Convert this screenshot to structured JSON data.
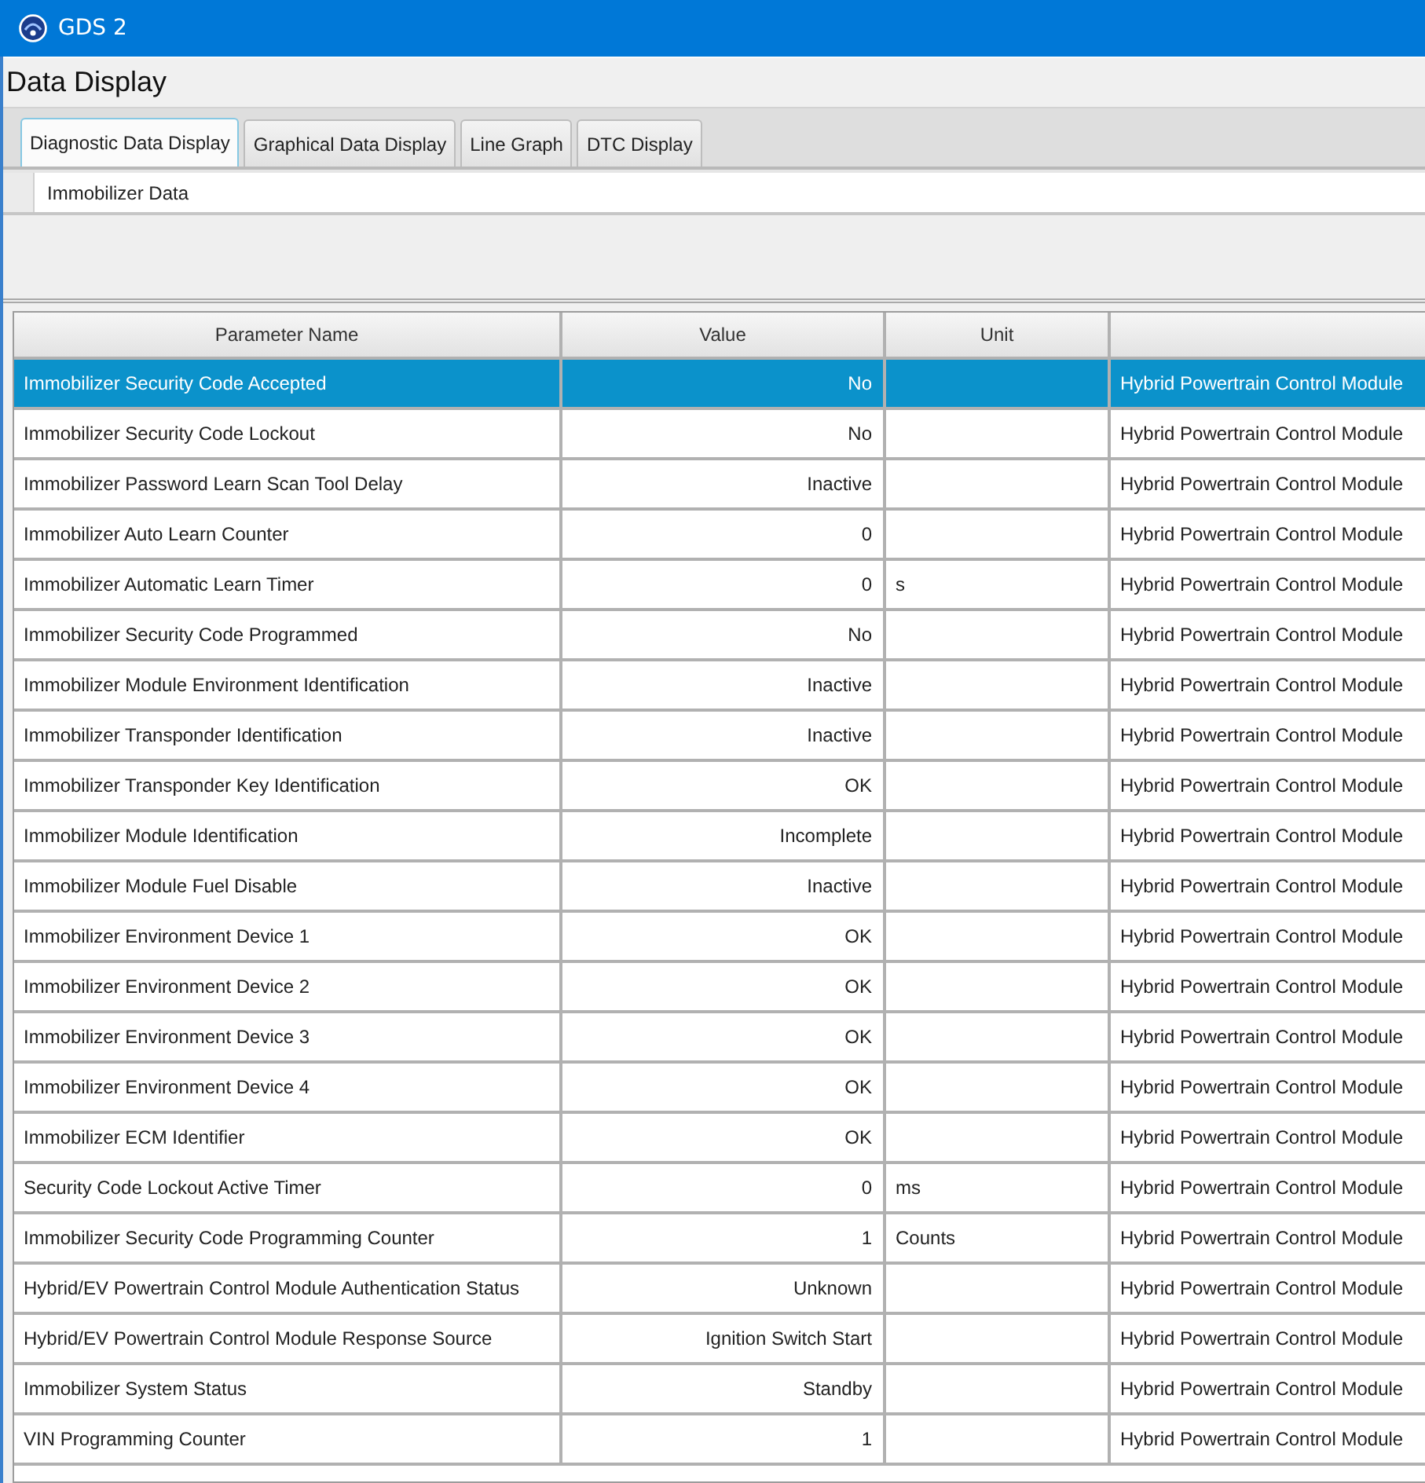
{
  "window": {
    "title": "GDS 2"
  },
  "header": {
    "title": "Data Display"
  },
  "tabs": [
    {
      "label": "Diagnostic Data Display",
      "selected": true
    },
    {
      "label": "Graphical Data Display",
      "selected": false
    },
    {
      "label": "Line Graph",
      "selected": false
    },
    {
      "label": "DTC Display",
      "selected": false
    }
  ],
  "group": {
    "label": "Immobilizer Data"
  },
  "table": {
    "columns": [
      "Parameter Name",
      "Value",
      "Unit"
    ],
    "rows": [
      {
        "parameter_name": "Immobilizer Security Code Accepted",
        "value": "No",
        "column_4": "Hybrid Powertrain Control Module",
        "selected": true
      },
      {
        "parameter_name": "Immobilizer Security Code Lockout",
        "value": "No",
        "column_4": "Hybrid Powertrain Control Module",
        "selected": false
      },
      {
        "parameter_name": "Immobilizer Password Learn Scan Tool Delay",
        "value": "Inactive",
        "column_4": "Hybrid Powertrain Control Module",
        "selected": false
      },
      {
        "parameter_name": "Immobilizer Auto Learn Counter",
        "value": "0",
        "column_4": "Hybrid Powertrain Control Module",
        "selected": false
      },
      {
        "parameter_name": "Immobilizer Automatic Learn Timer",
        "value": "0",
        "unit": "s",
        "column_4": "Hybrid Powertrain Control Module",
        "selected": false
      },
      {
        "parameter_name": "Immobilizer Security Code Programmed",
        "value": "No",
        "column_4": "Hybrid Powertrain Control Module",
        "selected": false
      },
      {
        "parameter_name": "Immobilizer Module Environment Identification",
        "value": "Inactive",
        "column_4": "Hybrid Powertrain Control Module",
        "selected": false
      },
      {
        "parameter_name": "Immobilizer Transponder Identification",
        "value": "Inactive",
        "column_4": "Hybrid Powertrain Control Module",
        "selected": false
      },
      {
        "parameter_name": "Immobilizer Transponder Key Identification",
        "value": "OK",
        "column_4": "Hybrid Powertrain Control Module",
        "selected": false
      },
      {
        "parameter_name": "Immobilizer Module Identification",
        "value": "Incomplete",
        "column_4": "Hybrid Powertrain Control Module",
        "selected": false
      },
      {
        "parameter_name": "Immobilizer Module Fuel Disable",
        "value": "Inactive",
        "column_4": "Hybrid Powertrain Control Module",
        "selected": false
      },
      {
        "parameter_name": "Immobilizer Environment Device 1",
        "value": "OK",
        "column_4": "Hybrid Powertrain Control Module",
        "selected": false
      },
      {
        "parameter_name": "Immobilizer Environment Device 2",
        "value": "OK",
        "column_4": "Hybrid Powertrain Control Module",
        "selected": false
      },
      {
        "parameter_name": "Immobilizer Environment Device 3",
        "value": "OK",
        "column_4": "Hybrid Powertrain Control Module",
        "selected": false
      },
      {
        "parameter_name": "Immobilizer Environment Device 4",
        "value": "OK",
        "column_4": "Hybrid Powertrain Control Module",
        "selected": false
      },
      {
        "parameter_name": "Immobilizer ECM Identifier",
        "value": "OK",
        "column_4": "Hybrid Powertrain Control Module",
        "selected": false
      },
      {
        "parameter_name": "Security Code Lockout Active Timer",
        "value": "0",
        "unit": "ms",
        "column_4": "Hybrid Powertrain Control Module",
        "selected": false
      },
      {
        "parameter_name": "Immobilizer Security Code Programming Counter",
        "value": "1",
        "unit": "Counts",
        "column_4": "Hybrid Powertrain Control Module",
        "selected": false
      },
      {
        "parameter_name": "Hybrid/EV Powertrain Control Module Authentication Status",
        "value": "Unknown",
        "column_4": "Hybrid Powertrain Control Module",
        "selected": false
      },
      {
        "parameter_name": "Hybrid/EV Powertrain Control Module Response Source",
        "value": "Ignition Switch Start",
        "column_4": "Hybrid Powertrain Control Module",
        "selected": false
      },
      {
        "parameter_name": "Immobilizer System Status",
        "value": "Standby",
        "column_4": "Hybrid Powertrain Control Module",
        "selected": false
      },
      {
        "parameter_name": "VIN Programming Counter",
        "value": "1",
        "column_4": "Hybrid Powertrain Control Module",
        "selected": false
      }
    ]
  }
}
